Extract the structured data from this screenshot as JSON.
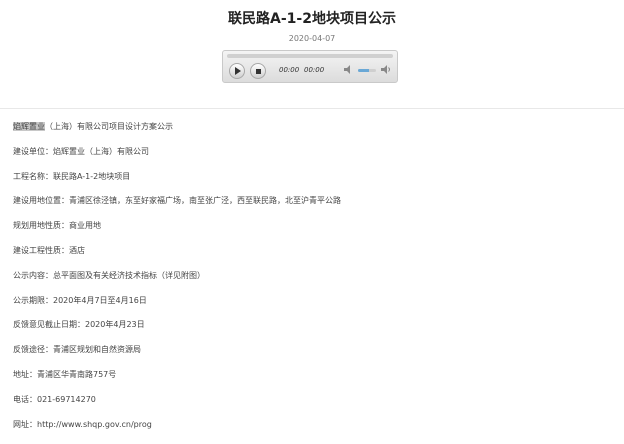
{
  "page": {
    "title": "联民路A-1-2地块项目公示",
    "date": "2020-04-07"
  },
  "player": {
    "current_time": "00:00",
    "duration": "00:00",
    "volume_level": 0.6,
    "icons": [
      "play-icon",
      "stop-icon",
      "volume-mute-icon",
      "volume-max-icon"
    ]
  },
  "content": {
    "first_line_highlight": "焰辉置业",
    "first_line_rest": "（上海）有限公司项目设计方案公示",
    "lines": [
      "建设单位：焰辉置业（上海）有限公司",
      "工程名称：联民路A-1-2地块项目",
      "建设用地位置：青浦区徐泾镇，东至好家福广场，南至张广泾，西至联民路，北至沪青平公路",
      "规划用地性质：商业用地",
      "建设工程性质：酒店",
      "公示内容：总平面图及有关经济技术指标（详见附图）",
      "公示期限：2020年4月7日至4月16日",
      "反馈意见截止日期：2020年4月23日",
      "反馈途径：青浦区规划和自然资源局",
      "地址：青浦区华青南路757号",
      "电话：021-69714270",
      "网址：http://www.shqp.gov.cn/prog"
    ]
  }
}
